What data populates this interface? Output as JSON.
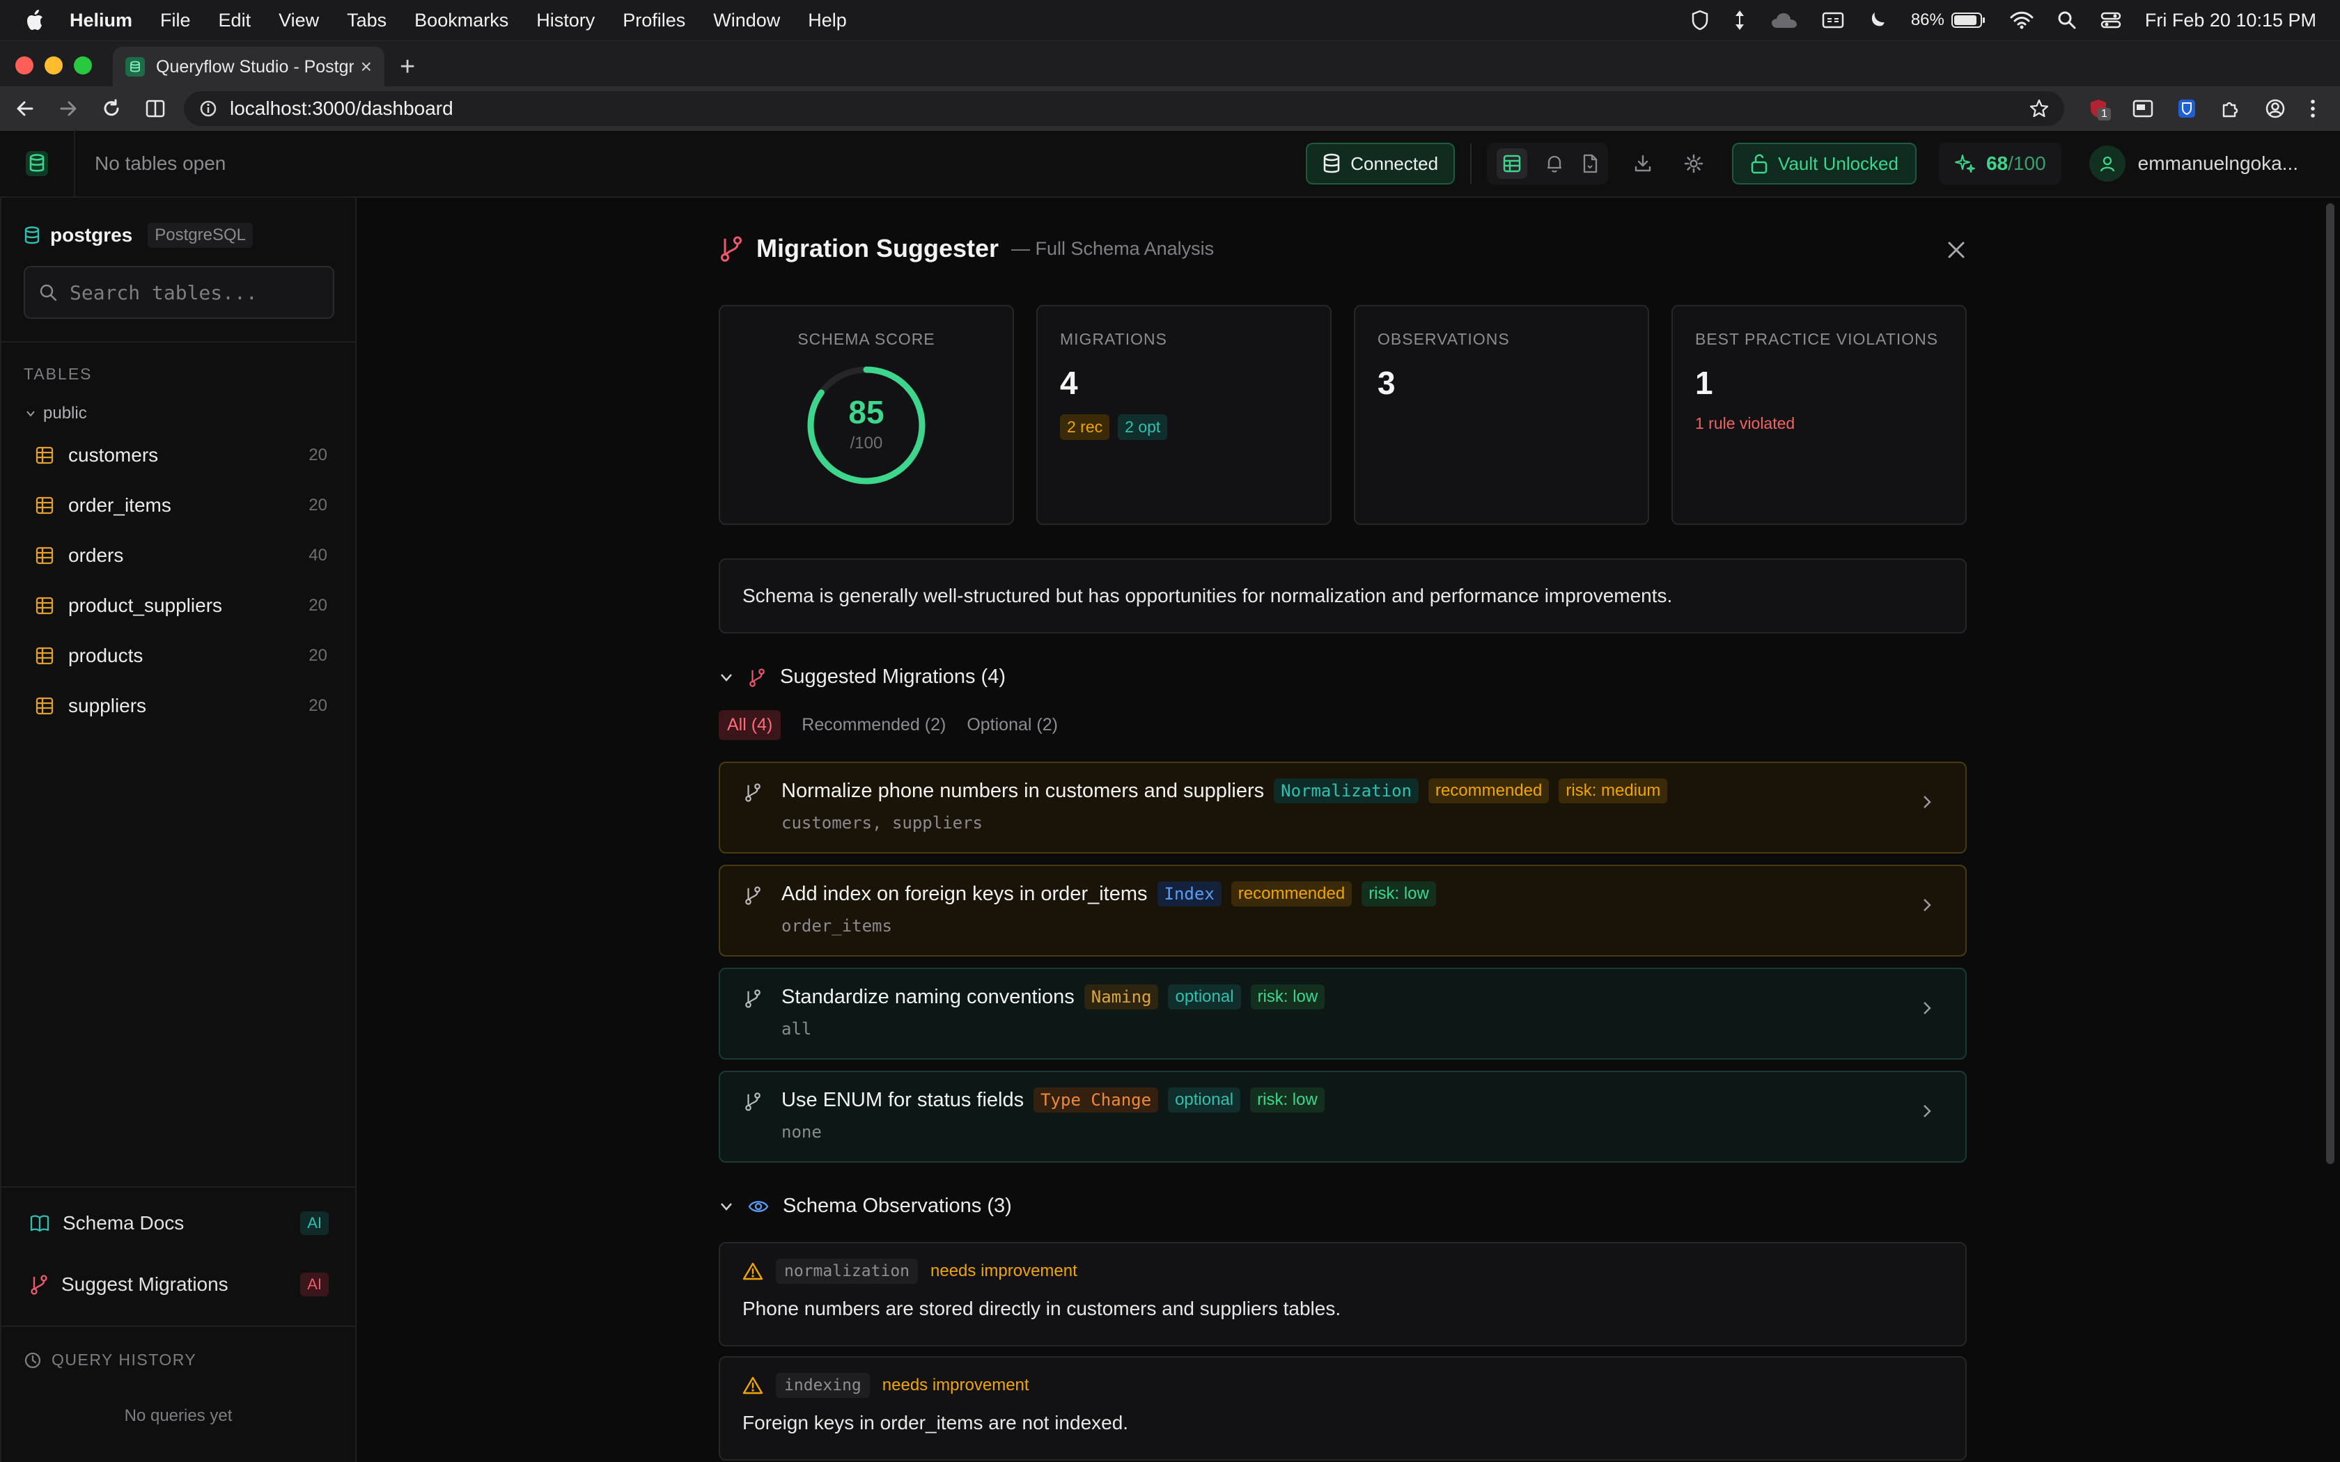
{
  "menubar": {
    "app": "Helium",
    "items": [
      "File",
      "Edit",
      "View",
      "Tabs",
      "Bookmarks",
      "History",
      "Profiles",
      "Window",
      "Help"
    ],
    "battery": "86%",
    "clock": "Fri Feb 20  10:15 PM"
  },
  "browser": {
    "tab_title": "Queryflow Studio - Postgres",
    "url": "localhost:3000/dashboard",
    "ext_badge": "1"
  },
  "header": {
    "no_tables": "No tables open",
    "connected": "Connected",
    "vault": "Vault Unlocked",
    "score_num": "68",
    "score_den": "/100",
    "user": "emmanuelngoka..."
  },
  "sidebar": {
    "db_name": "postgres",
    "db_kind": "PostgreSQL",
    "search_placeholder": "Search tables...",
    "tables_label": "TABLES",
    "schema": "public",
    "tables": [
      {
        "name": "customers",
        "count": "20"
      },
      {
        "name": "order_items",
        "count": "20"
      },
      {
        "name": "orders",
        "count": "40"
      },
      {
        "name": "product_suppliers",
        "count": "20"
      },
      {
        "name": "products",
        "count": "20"
      },
      {
        "name": "suppliers",
        "count": "20"
      }
    ],
    "schema_docs": "Schema Docs",
    "suggest_migrations": "Suggest Migrations",
    "ai_badge": "AI",
    "query_history": "QUERY HISTORY",
    "no_queries": "No queries yet"
  },
  "panel": {
    "title": "Migration Suggester",
    "subtitle": "— Full Schema Analysis",
    "cards": {
      "score_label": "SCHEMA SCORE",
      "score": 85,
      "score_den": "/100",
      "migrations_label": "MIGRATIONS",
      "migrations": "4",
      "rec_chip": "2 rec",
      "opt_chip": "2 opt",
      "observations_label": "OBSERVATIONS",
      "observations": "3",
      "violations_label": "BEST PRACTICE VIOLATIONS",
      "violations": "1",
      "violations_note": "1 rule violated"
    },
    "summary": "Schema is generally well-structured but has opportunities for normalization and performance improvements.",
    "migrations_heading": "Suggested Migrations (4)",
    "filters": {
      "all": "All (4)",
      "recommended": "Recommended (2)",
      "optional": "Optional (2)"
    },
    "migrations": [
      {
        "title": "Normalize phone numbers in customers and suppliers",
        "category": "Normalization",
        "status": "recommended",
        "risk": "risk: medium",
        "tables": "customers, suppliers"
      },
      {
        "title": "Add index on foreign keys in order_items",
        "category": "Index",
        "status": "recommended",
        "risk": "risk: low",
        "tables": "order_items"
      },
      {
        "title": "Standardize naming conventions",
        "category": "Naming",
        "status": "optional",
        "risk": "risk: low",
        "tables": "all"
      },
      {
        "title": "Use ENUM for status fields",
        "category": "Type Change",
        "status": "optional",
        "risk": "risk: low",
        "tables": "none"
      }
    ],
    "observations_heading": "Schema Observations (3)",
    "observations": [
      {
        "category": "normalization",
        "severity": "needs improvement",
        "text": "Phone numbers are stored directly in customers and suppliers tables."
      },
      {
        "category": "indexing",
        "severity": "needs improvement",
        "text": "Foreign keys in order_items are not indexed."
      }
    ]
  },
  "colors": {
    "accent_green": "#3dd68c",
    "accent_red": "#f0596b",
    "warn": "#f0a500",
    "teal": "#2fc0b0"
  }
}
